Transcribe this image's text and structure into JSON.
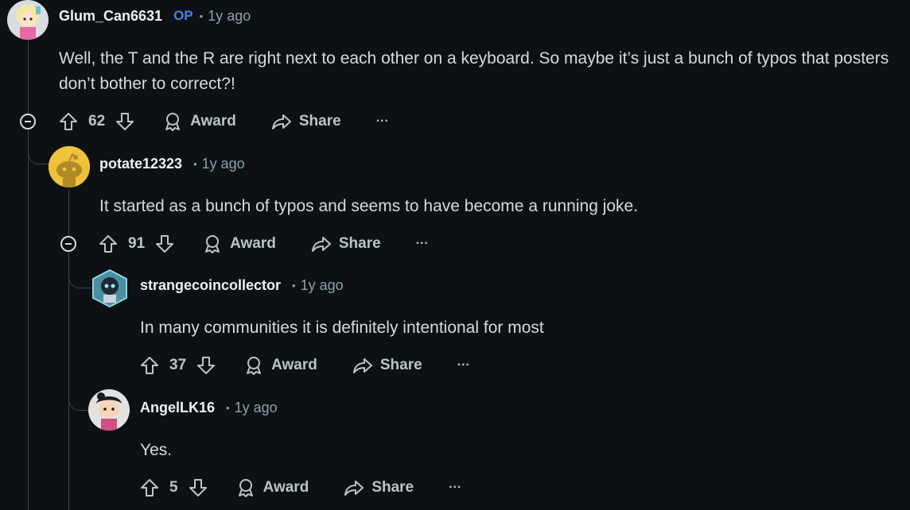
{
  "comments": [
    {
      "username": "Glum_Can6631",
      "op_badge": "OP",
      "separator": "•",
      "time": "1y ago",
      "body": "Well, the T and the R are right next to each other on a keyboard. So maybe it’s just a bunch of typos that posters don’t bother to correct?!",
      "votes": "62",
      "award_label": "Award",
      "share_label": "Share",
      "more_label": "···",
      "avatar_icon": "anime-girl-avatar-icon"
    },
    {
      "username": "potate12323",
      "separator": "•",
      "time": "1y ago",
      "body": "It started as a bunch of typos and seems to have become a running joke.",
      "votes": "91",
      "award_label": "Award",
      "share_label": "Share",
      "more_label": "···",
      "avatar_icon": "default-snoo-avatar-icon"
    },
    {
      "username": "strangecoincollector",
      "separator": "•",
      "time": "1y ago",
      "body": "In many communities it is definitely intentional for most",
      "votes": "37",
      "award_label": "Award",
      "share_label": "Share",
      "more_label": "···",
      "avatar_icon": "robot-hex-avatar-icon"
    },
    {
      "username": "AngelLK16",
      "separator": "•",
      "time": "1y ago",
      "body": "Yes.",
      "votes": "5",
      "award_label": "Award",
      "share_label": "Share",
      "more_label": "···",
      "avatar_icon": "snoo-avatar-icon"
    }
  ],
  "colors": {
    "background": "#0e1113",
    "op_badge": "#4b80e8",
    "meta": "#8ba2ad",
    "thread_line": "#3e4447"
  }
}
